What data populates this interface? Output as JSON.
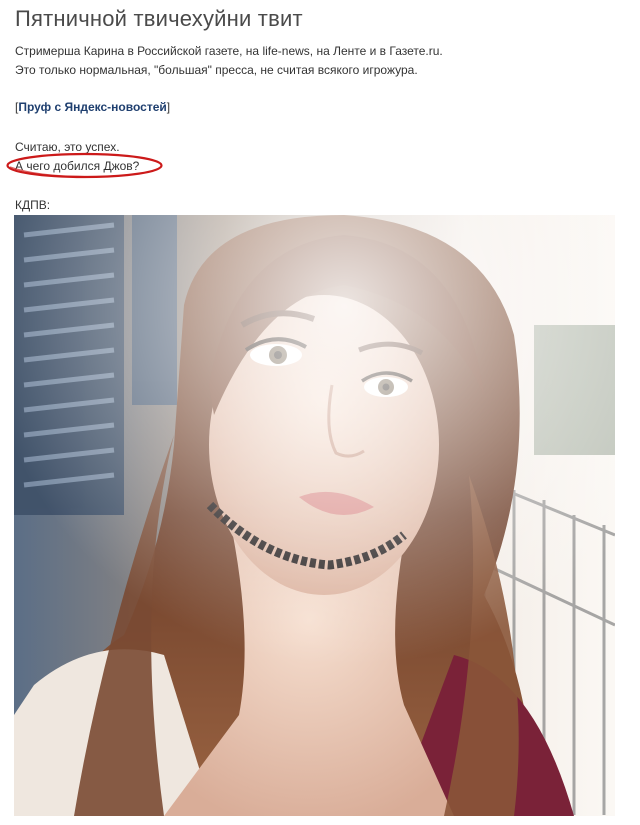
{
  "post": {
    "title": "Пятничной твичехуйни твит",
    "line1": "Стримерша Карина в Российской газете, на life-news, на Ленте и в Газете.ru.",
    "line2": "Это только нормальная, \"большая\" пресса, не считая всякого игрожура.",
    "link_open": "[",
    "link_text": "Пруф с Яндекс-новостей",
    "link_close": "]",
    "line3": "Считаю, это успех.",
    "line4": "А чего добился Джов?",
    "caption": "КДПВ:",
    "highlight_color": "#cc1a1a",
    "link_color": "#1f3f6f"
  }
}
